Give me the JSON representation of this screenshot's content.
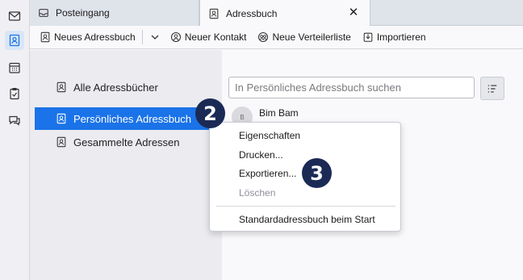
{
  "tabs": {
    "inbox_label": "Posteingang",
    "addressbook_label": "Adressbuch",
    "close_glyph": "✕"
  },
  "toolbar": {
    "new_addressbook": "Neues Adressbuch",
    "new_contact": "Neuer Kontakt",
    "new_list": "Neue Verteilerliste",
    "import": "Importieren"
  },
  "sidebar": {
    "items": [
      {
        "label": "Alle Adressbücher"
      },
      {
        "label": "Persönliches Adressbuch"
      },
      {
        "label": "Gesammelte Adressen"
      }
    ]
  },
  "main": {
    "search_placeholder": "In Persönliches Adressbuch suchen",
    "contact_name": "Bim Bam",
    "contact_initials": "B"
  },
  "context_menu": {
    "items": [
      {
        "label": "Eigenschaften"
      },
      {
        "label": "Drucken..."
      },
      {
        "label": "Exportieren..."
      },
      {
        "label": "Löschen"
      },
      {
        "label": "Standardadressbuch beim Start"
      }
    ]
  },
  "badges": {
    "step_two": "2",
    "step_three": "3"
  },
  "colors": {
    "selection": "#1a73e8",
    "badge": "#1b2a55"
  }
}
